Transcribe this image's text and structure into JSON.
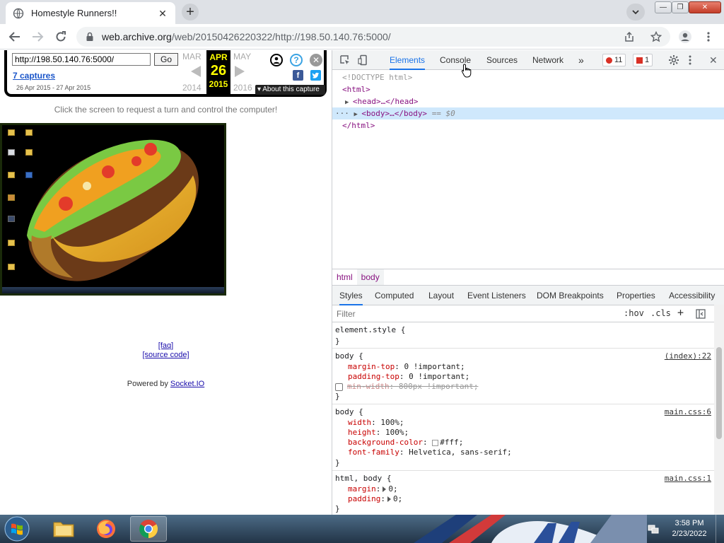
{
  "browser": {
    "tab_title": "Homestyle Runners!!",
    "url_domain": "web.archive.org",
    "url_path": "/web/20150426220322/http://198.50.140.76:5000/"
  },
  "wayback": {
    "url_value": "http://198.50.140.76:5000/",
    "go_label": "Go",
    "captures_label": "7 captures",
    "date_range": "26 Apr 2015 - 27 Apr 2015",
    "prev_month": "MAR",
    "cur_month": "APR",
    "next_month": "MAY",
    "cur_day": "26",
    "prev_year": "2014",
    "cur_year": "2015",
    "next_year": "2016",
    "about_label": "About this capture"
  },
  "page": {
    "click_message": "Click the screen to request a turn and control the computer!",
    "faq_link": "[faq]",
    "source_link": "[source code]",
    "powered_prefix": "Powered by ",
    "powered_link": "Socket.IO"
  },
  "devtools": {
    "tabs": [
      "Elements",
      "Console",
      "Sources",
      "Network"
    ],
    "active_tab": "Elements",
    "error_count": "11",
    "issue_count": "1",
    "dom": {
      "doctype": "<!DOCTYPE html>",
      "html_open": "<html>",
      "head": "<head>…</head>",
      "body": "<body>…</body>",
      "body_marker": "== $0",
      "html_close": "</html>"
    },
    "breadcrumbs": [
      "html",
      "body"
    ],
    "sub_tabs": [
      "Styles",
      "Computed",
      "Layout",
      "Event Listeners",
      "DOM Breakpoints",
      "Properties",
      "Accessibility"
    ],
    "filter_placeholder": "Filter",
    "hov_label": ":hov",
    "cls_label": ".cls",
    "rules": {
      "element_style": "element.style {",
      "body1_selector": "body {",
      "body1_src": "(index):22",
      "body1_p1_name": "margin-top",
      "body1_p1_val": "0 !important;",
      "body1_p2_name": "padding-top",
      "body1_p2_val": "0 !important;",
      "body1_p3_name": "min-width",
      "body1_p3_val": "800px !important;",
      "body2_selector": "body {",
      "body2_src": "main.css:6",
      "body2_p1_name": "width",
      "body2_p1_val": "100%;",
      "body2_p2_name": "height",
      "body2_p2_val": "100%;",
      "body2_p3_name": "background-color",
      "body2_p3_val": "#fff;",
      "body2_p4_name": "font-family",
      "body2_p4_val": "Helvetica, sans-serif;",
      "html_selector": "html, body {",
      "html_src": "main.css:1",
      "html_p1_name": "margin",
      "html_p1_val": "0;",
      "html_p2_name": "padding",
      "html_p2_val": "0;",
      "close_brace": "}"
    }
  },
  "taskbar": {
    "time": "3:58 PM",
    "date": "2/23/2022"
  },
  "colors": {
    "devtools_accent": "#1a73e8",
    "wayback_highlight": "#ffff00",
    "error_red": "#d93025"
  }
}
